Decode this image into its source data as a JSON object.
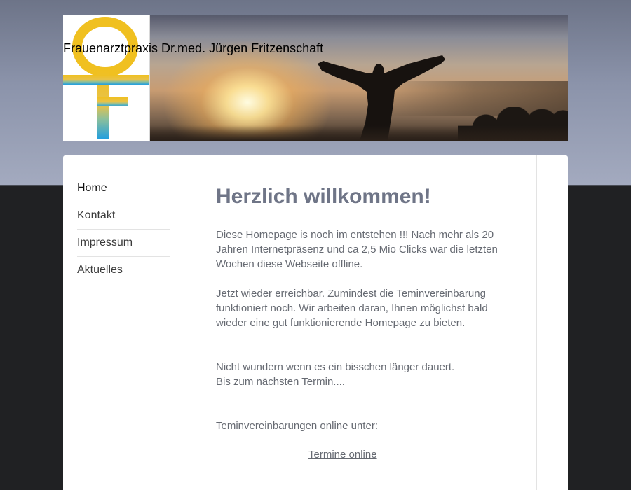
{
  "header": {
    "site_title": "Frauenarztpraxis Dr.med. Jürgen Fritzenschaft"
  },
  "nav": {
    "items": [
      "Home",
      "Kontakt",
      "Impressum",
      "Aktuelles"
    ],
    "active": "Home"
  },
  "main": {
    "heading": "Herzlich willkommen!",
    "paragraphs": [
      [
        "Diese Homepage is noch im entstehen !!!  Nach mehr als 20",
        "Jahren Internetpräsenz und ca 2,5 Mio Clicks war die letzten",
        "Wochen diese Webseite offline."
      ],
      [
        "Jetzt wieder erreichbar. Zumindest die Teminvereinbarung",
        "funktioniert noch. Wir arbeiten daran, Ihnen möglichst bald",
        "wieder eine gut funktionierende Homepage zu bieten."
      ],
      [
        "Nicht wundern wenn es ein bisschen länger dauert.",
        "Bis zum nächsten Termin...."
      ],
      [
        "Teminvereinbarungen online unter:"
      ]
    ],
    "link_label": "Termine online"
  },
  "colors": {
    "heading": "#6f7587",
    "body_text": "#666a72",
    "page_background": "#202123",
    "logo_yellow": "#e8be2a",
    "logo_blue": "#2aa3d8"
  }
}
